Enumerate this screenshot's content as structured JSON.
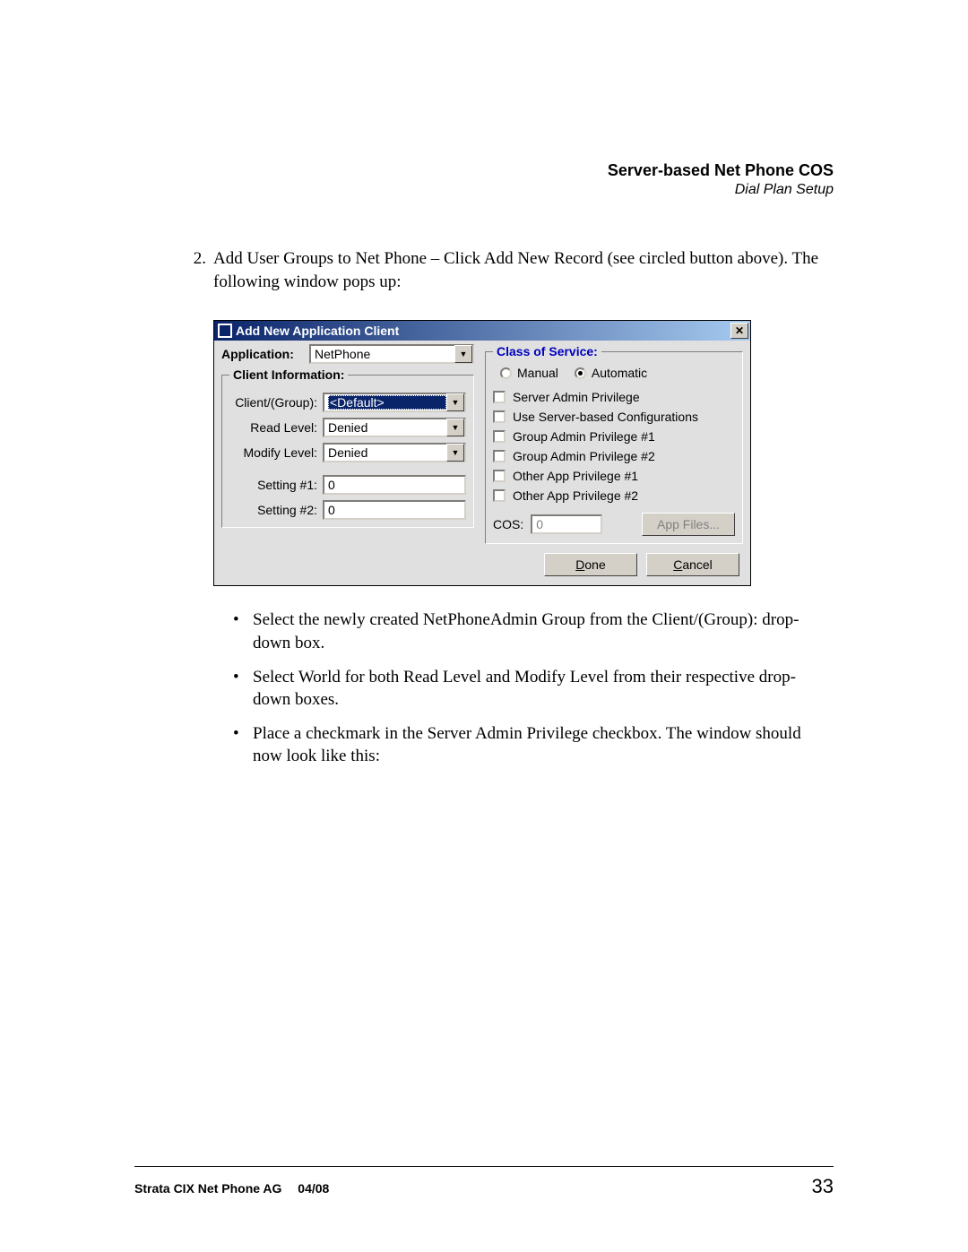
{
  "header": {
    "title": "Server-based Net Phone COS",
    "subtitle": "Dial Plan Setup"
  },
  "step": {
    "number": "2.",
    "text": "Add User Groups to Net Phone – Click Add New Record (see circled button above). The following window pops up:"
  },
  "dialog": {
    "title": "Add New Application Client",
    "application_label": "Application:",
    "application_value": "NetPhone",
    "client_info_legend": "Client Information:",
    "fields": {
      "client_group_label": "Client/(Group):",
      "client_group_value": "<Default>",
      "read_level_label": "Read Level:",
      "read_level_value": "Denied",
      "modify_level_label": "Modify Level:",
      "modify_level_value": "Denied",
      "setting1_label": "Setting #1:",
      "setting1_value": "0",
      "setting2_label": "Setting #2:",
      "setting2_value": "0"
    },
    "cos": {
      "legend": "Class of Service:",
      "manual_label": "Manual",
      "automatic_label": "Automatic",
      "selected": "Automatic",
      "checkboxes": [
        "Server Admin Privilege",
        "Use Server-based Configurations",
        "Group Admin Privilege #1",
        "Group Admin Privilege #2",
        "Other App Privilege #1",
        "Other App Privilege #2"
      ],
      "cos_label": "COS:",
      "cos_value": "0",
      "app_files_label": "App Files..."
    },
    "done_label": "Done",
    "cancel_label": "Cancel"
  },
  "bullets": [
    "Select the newly created NetPhoneAdmin Group from the Client/(Group): drop-down box.",
    "Select World for both Read Level and Modify Level from their respective drop-down boxes.",
    "Place a checkmark in the Server Admin Privilege checkbox. The window should now look like this:"
  ],
  "footer": {
    "doc": "Strata CIX Net Phone AG",
    "date": "04/08",
    "page": "33"
  }
}
